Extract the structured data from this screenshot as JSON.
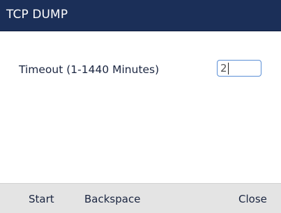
{
  "titlebar": {
    "title": "TCP DUMP"
  },
  "timeout_field": {
    "label": "Timeout (1-1440 Minutes)",
    "value": "2"
  },
  "softkeys": {
    "start": "Start",
    "backspace": "Backspace",
    "close": "Close"
  },
  "colors": {
    "titlebar_bg": "#1b2f58",
    "softkey_bar_bg": "#e4e4e4",
    "input_border_focus": "#5b8fd6"
  }
}
